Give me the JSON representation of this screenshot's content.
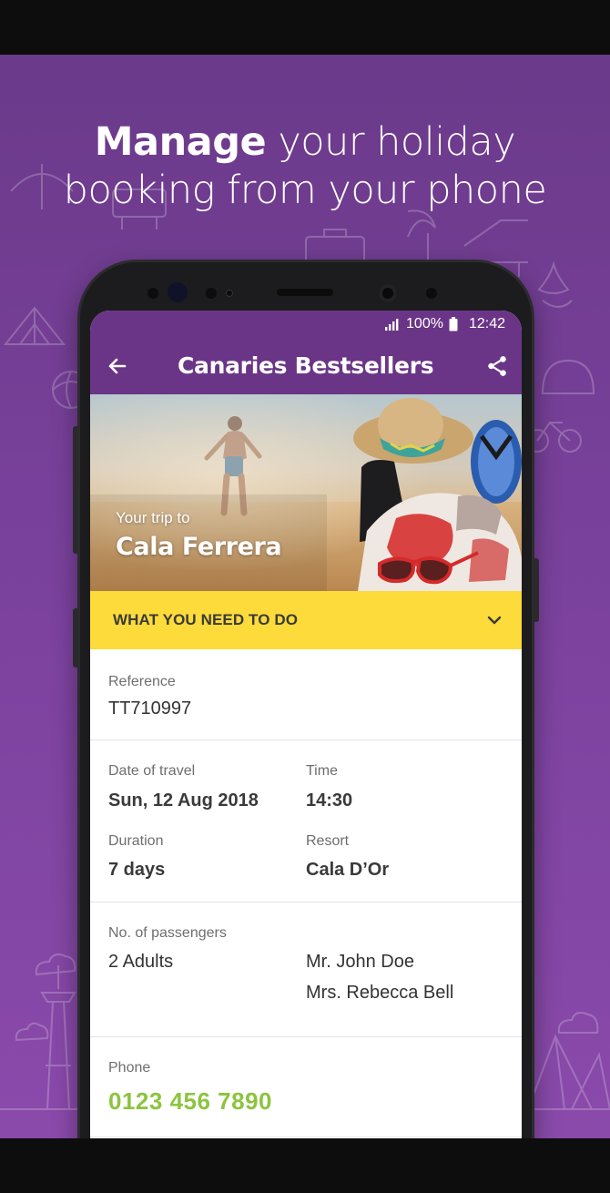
{
  "headline": {
    "strong": "Manage",
    "line1_rest": " your holiday",
    "line2": "booking from your phone"
  },
  "status_bar": {
    "signal_icon": "signal-icon",
    "battery_text": "100%",
    "battery_icon": "battery-icon",
    "time": "12:42"
  },
  "app_bar": {
    "back_icon": "arrow-left-icon",
    "title": "Canaries Bestsellers",
    "share_icon": "share-icon"
  },
  "hero": {
    "subtitle": "Your trip to",
    "destination": "Cala Ferrera"
  },
  "todo": {
    "label": "WHAT YOU NEED TO DO",
    "icon": "chevron-down-icon"
  },
  "booking": {
    "reference_label": "Reference",
    "reference_value": "TT710997",
    "date_label": "Date of travel",
    "date_value": "Sun, 12 Aug 2018",
    "time_label": "Time",
    "time_value": "14:30",
    "duration_label": "Duration",
    "duration_value": "7 days",
    "resort_label": "Resort",
    "resort_value": "Cala D’Or",
    "passengers_label": "No. of passengers",
    "passengers_value": "2 Adults",
    "passenger_names": [
      "Mr. John Doe",
      "Mrs. Rebecca Bell"
    ],
    "phone_label": "Phone",
    "phone_value": "0123 456 7890"
  },
  "colors": {
    "background": "#7a419c",
    "app_bar": "#6a3586",
    "todo_bar": "#fcdb3a",
    "phone_link": "#8cc43f"
  }
}
